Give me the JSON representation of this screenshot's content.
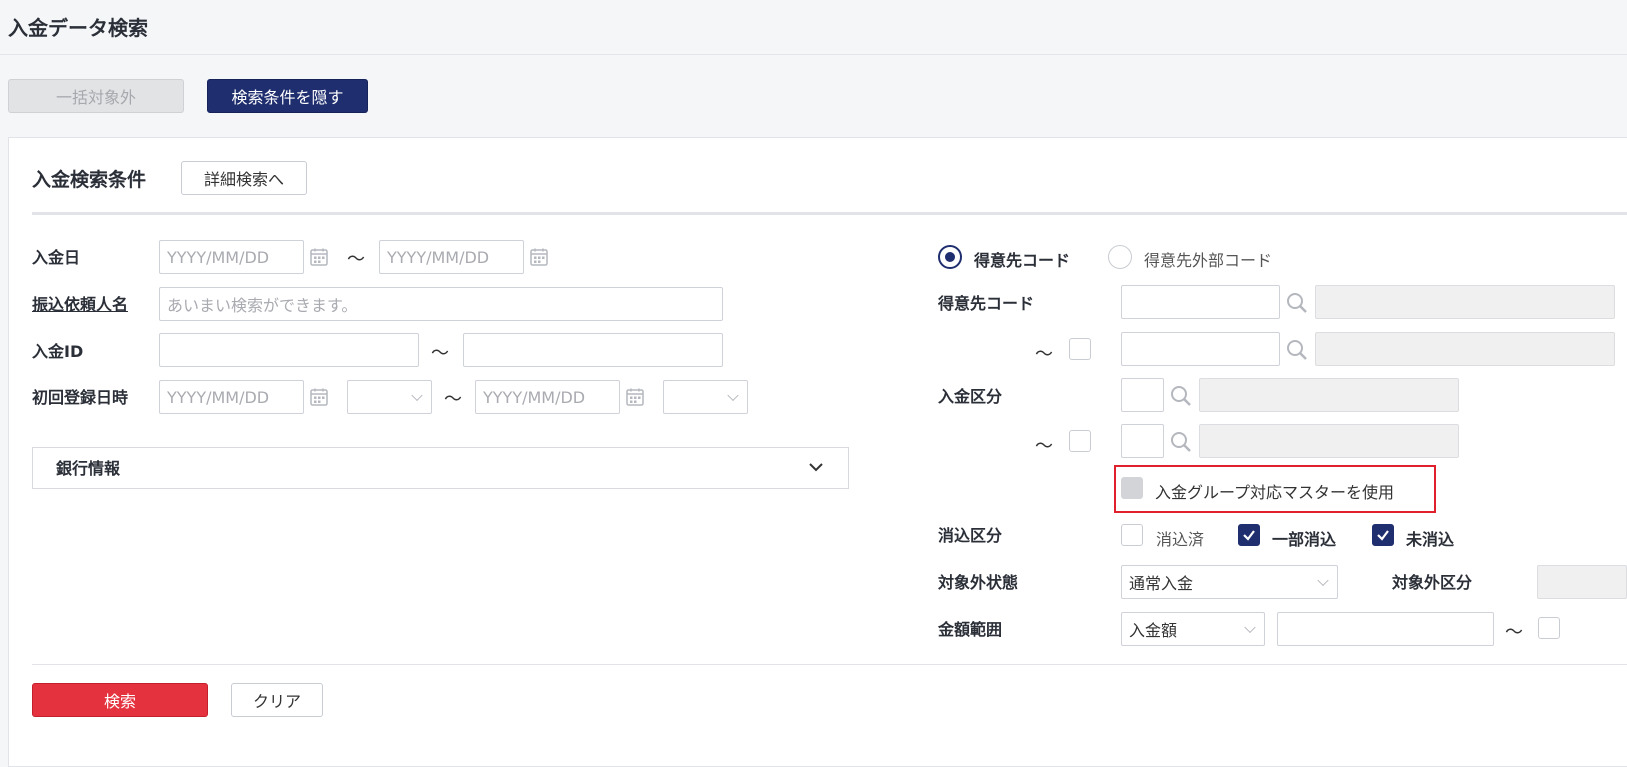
{
  "page": {
    "title": "入金データ検索"
  },
  "toolbar": {
    "bulk_exclude_label": "一括対象外",
    "hide_conditions_label": "検索条件を隠す"
  },
  "search": {
    "section_title": "入金検索条件",
    "detail_button_label": "詳細検索へ",
    "tilde": "〜",
    "deposit_date": {
      "label": "入金日",
      "from_placeholder": "YYYY/MM/DD",
      "to_placeholder": "YYYY/MM/DD"
    },
    "payer_name": {
      "label": "振込依頼人名",
      "placeholder": "あいまい検索ができます。"
    },
    "deposit_id": {
      "label": "入金ID",
      "from_value": "",
      "to_value": ""
    },
    "first_registered": {
      "label": "初回登録日時",
      "from_placeholder": "YYYY/MM/DD",
      "to_placeholder": "YYYY/MM/DD",
      "from_time": "",
      "to_time": ""
    },
    "bank_info": {
      "label": "銀行情報",
      "expanded": false
    },
    "customer_code_type": {
      "options": [
        "得意先コード",
        "得意先外部コード"
      ],
      "selected": "得意先コード"
    },
    "customer_code": {
      "label": "得意先コード",
      "from_value": "",
      "to_value": "",
      "to_checked": false
    },
    "deposit_category": {
      "label": "入金区分",
      "from_value": "",
      "to_value": "",
      "to_checked": false
    },
    "group_master": {
      "label": "入金グループ対応マスターを使用",
      "checked": false,
      "disabled": true
    },
    "reconcile": {
      "label": "消込区分",
      "options": [
        {
          "label": "消込済",
          "checked": false
        },
        {
          "label": "一部消込",
          "checked": true
        },
        {
          "label": "未消込",
          "checked": true
        }
      ]
    },
    "exclusion_status": {
      "label": "対象外状態",
      "value": "通常入金"
    },
    "exclusion_category": {
      "label": "対象外区分",
      "value": ""
    },
    "amount_range": {
      "label": "金額範囲",
      "type_value": "入金額",
      "from_value": "",
      "to_checked": false
    }
  },
  "actions": {
    "search_label": "検索",
    "clear_label": "クリア"
  },
  "colors": {
    "navy": "#1f2e6e",
    "red": "#e5323f",
    "highlight_border": "#e0202c"
  },
  "icons": {
    "calendar": "calendar-icon",
    "search": "search-icon",
    "chevron": "chevron-down-icon"
  }
}
